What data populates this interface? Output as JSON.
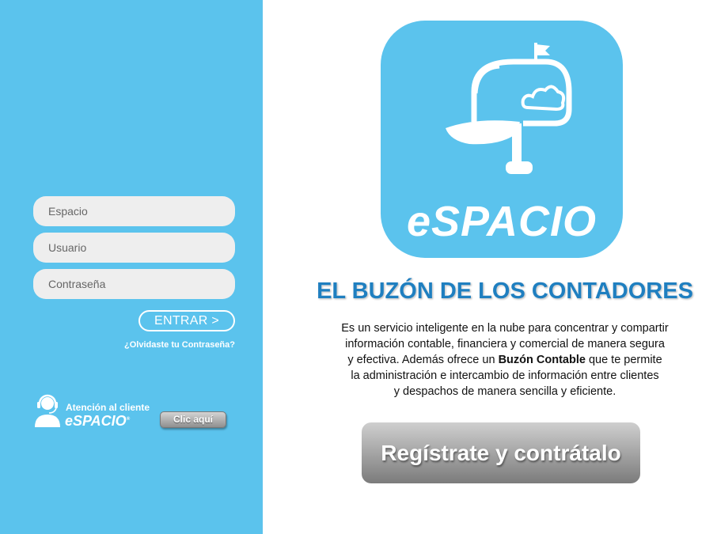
{
  "login": {
    "space_placeholder": "Espacio",
    "user_placeholder": "Usuario",
    "password_placeholder": "Contraseña",
    "submit_label": "ENTRAR >",
    "forgot_link": "¿Olvidaste tu Contraseña?"
  },
  "support": {
    "line1": "Atención al cliente",
    "brand": "eSPACIO",
    "trademark": "®",
    "button_label": "Clic aquí"
  },
  "logo": {
    "wordmark": "eSPACIO",
    "icon": "mailbox-cloud-icon",
    "color": "#5bc3ed"
  },
  "headline": "EL BUZÓN DE LOS CONTADORES",
  "description": {
    "line1": "Es un servicio inteligente en la nube para concentrar y compartir",
    "line2": "información contable, financiera y comercial de manera segura",
    "line3_pre": "y efectiva. Además ofrece un ",
    "line3_bold": "Buzón Contable",
    "line3_post": " que te permite",
    "line4": "la administración e intercambio de información entre clientes",
    "line5": "y despachos de manera sencilla y eficiente."
  },
  "register_label": "Regístrate y contrátalo",
  "colors": {
    "panel": "#5bc3ed",
    "headline": "#1f7fc0"
  }
}
